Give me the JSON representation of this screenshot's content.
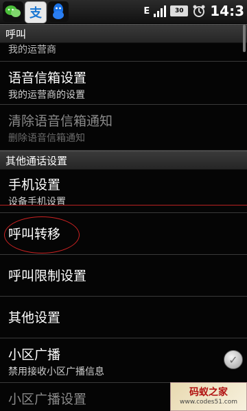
{
  "status_bar": {
    "time": "14:3",
    "battery": "30",
    "network": "E"
  },
  "sections": [
    {
      "header": "呼叫"
    },
    {
      "header": "其他通话设置"
    }
  ],
  "items": [
    {
      "title": "",
      "subtitle": "我的运营商"
    },
    {
      "title": "语音信箱设置",
      "subtitle": "我的运营商的设置"
    },
    {
      "title": "清除语音信箱通知",
      "subtitle": "删除语音信箱通知"
    },
    {
      "title": "手机设置",
      "subtitle": "设备手机设置"
    },
    {
      "title": "呼叫转移",
      "subtitle": ""
    },
    {
      "title": "呼叫限制设置",
      "subtitle": ""
    },
    {
      "title": "其他设置",
      "subtitle": ""
    },
    {
      "title": "小区广播",
      "subtitle": "禁用接收小区广播信息"
    },
    {
      "title": "小区广播设置",
      "subtitle": ""
    }
  ],
  "watermark": {
    "title": "码蚁之家",
    "url": "www.codes51.com"
  },
  "icons": [
    "wechat-icon",
    "zhi-icon",
    "qq-icon",
    "signal-icon",
    "battery-icon",
    "alarm-icon"
  ]
}
